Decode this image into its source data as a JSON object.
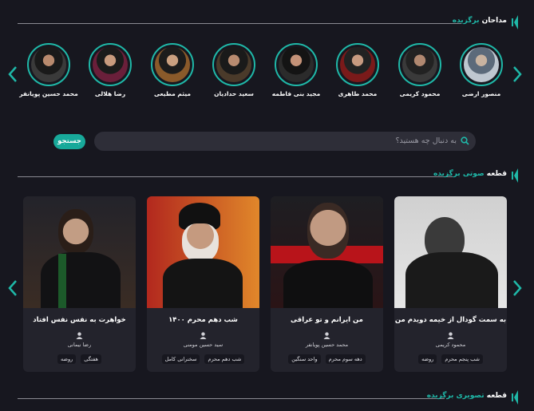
{
  "colors": {
    "accent": "#1fb8a8",
    "background": "#17171f",
    "card": "#23232c"
  },
  "sections": {
    "singers": {
      "title": "مداحان",
      "accent": "برگزیده"
    },
    "audio": {
      "title": "قطعه",
      "accent": "صوتی برگزیده"
    },
    "images": {
      "title": "قطعه",
      "accent": "تصویری برگزیده"
    }
  },
  "singers": [
    {
      "name": "منصور ارضی"
    },
    {
      "name": "محمود کریمی"
    },
    {
      "name": "محمد طاهری"
    },
    {
      "name": "مجید بنی فاطمه"
    },
    {
      "name": "سعید حدادیان"
    },
    {
      "name": "میثم مطیعی"
    },
    {
      "name": "رضا هلالی"
    },
    {
      "name": "محمد حسین پویانفر"
    }
  ],
  "search": {
    "placeholder": "به دنبال چه هستید؟",
    "button": "جستجو"
  },
  "cards": [
    {
      "title": "به سمت گودال از خیمه دویدم من",
      "artist": "محمود کریمی",
      "tags": [
        "شب پنجم محرم",
        "روضه"
      ]
    },
    {
      "title": "من ایرانم و تو عراقی",
      "artist": "محمد حسین پویانفر",
      "tags": [
        "دهه سوم محرم",
        "واحد سنگین"
      ]
    },
    {
      "title": "شب دهم محرم ۱۴۰۰",
      "artist": "سید حسین مومنی",
      "tags": [
        "شب دهم محرم",
        "سخنرانی کامل"
      ]
    },
    {
      "title": "خواهرت به نفس نفس افتاد",
      "artist": "رضا نیمانی",
      "tags": [
        "هفتگی",
        "روضه"
      ]
    }
  ],
  "icons": {
    "prev": "chevron-left-icon",
    "next": "chevron-right-icon",
    "search": "search-icon",
    "user": "user-icon"
  }
}
